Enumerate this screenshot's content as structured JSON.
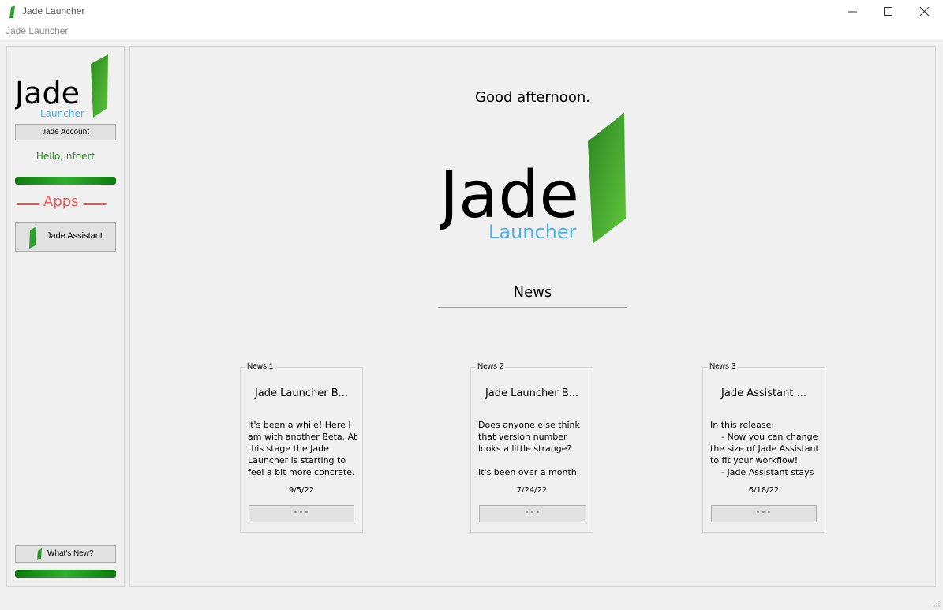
{
  "window": {
    "title": "Jade Launcher",
    "menubar_label": "Jade Launcher"
  },
  "sidebar": {
    "logo_word": "Jade",
    "logo_sub": "Launcher",
    "account_button": "Jade Account",
    "hello": "Hello, nfoert",
    "apps_heading": "Apps",
    "apps": [
      {
        "label": "Jade Assistant",
        "icon": "jade-leaf-icon"
      }
    ],
    "whats_new_button": "What's New?"
  },
  "main": {
    "greeting": "Good afternoon.",
    "logo_word": "Jade",
    "logo_sub": "Launcher",
    "news_heading": "News",
    "news": [
      {
        "legend": "News 1",
        "title": "Jade Launcher B...",
        "body": "It's been a while! Here I am with another Beta. At this stage the Jade Launcher is starting to feel a bit more concrete.",
        "date": "9/5/22",
        "more": "•••"
      },
      {
        "legend": "News 2",
        "title": "Jade Launcher B...",
        "body": "Does anyone else think that version number looks a little strange?\n\nIt's been over a month",
        "date": "7/24/22",
        "more": "•••"
      },
      {
        "legend": "News 3",
        "title": "Jade Assistant ...",
        "body": "In this release:\n    - Now you can change the size of Jade Assistant to fit your workflow!\n    - Jade Assistant stays",
        "date": "6/18/22",
        "more": "•••"
      }
    ]
  },
  "colors": {
    "jade_green": "#2e9e2e",
    "launcher_blue": "#4ab3ea",
    "apps_red": "#ee5a5a",
    "hello_green": "#1e8c1e"
  }
}
